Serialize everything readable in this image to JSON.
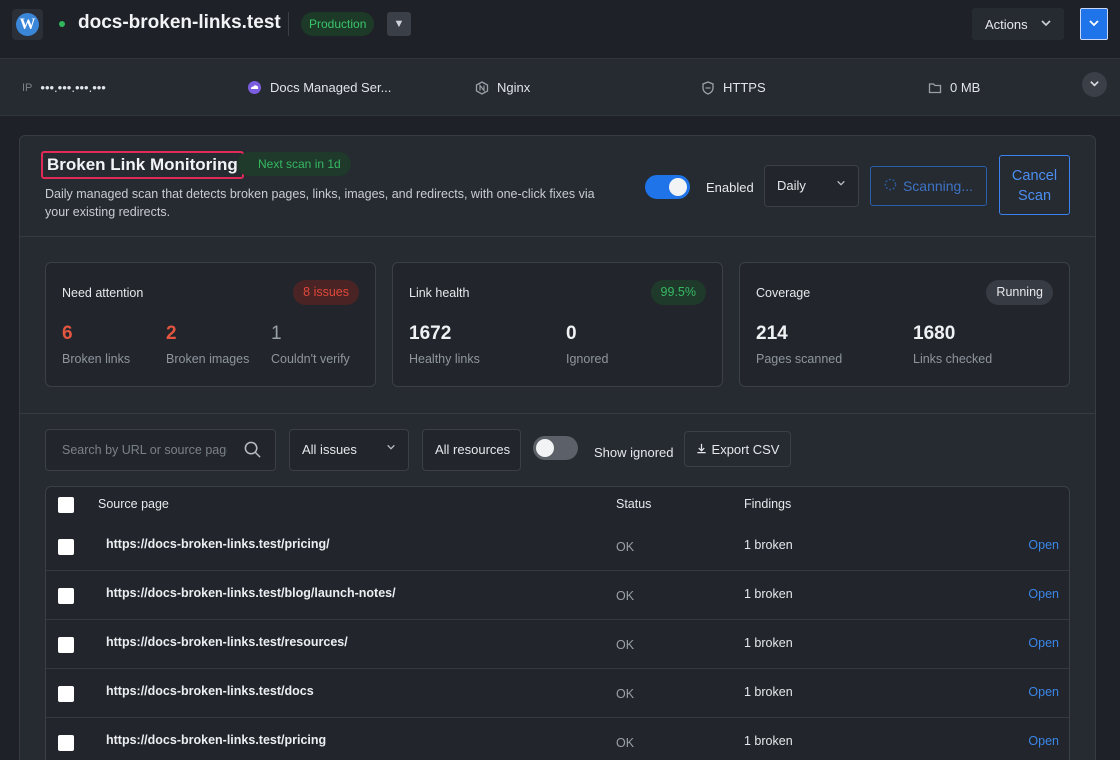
{
  "topbar": {
    "site_title": "docs-broken-links.test",
    "environment": "Production",
    "actions_label": "Actions",
    "logo_letter": "W"
  },
  "infobar": {
    "ip_label": "IP",
    "ip_value": "•••.•••.•••.•••",
    "service": "Docs Managed Ser...",
    "server": "Nginx",
    "https": "HTTPS",
    "storage": "0 MB"
  },
  "monitor": {
    "title": "Broken Link Monitoring",
    "next_scan": "Next scan in 1d",
    "description": "Daily managed scan that detects broken pages, links, images, and redirects, with one-click fixes via your existing redirects.",
    "enabled_label": "Enabled",
    "enabled": true,
    "frequency": "Daily",
    "scanning_label": "Scanning...",
    "cancel_label_1": "Cancel",
    "cancel_label_2": "Scan"
  },
  "stats": {
    "attention": {
      "title": "Need attention",
      "badge": "8 issues",
      "m1_value": "6",
      "m1_label": "Broken links",
      "m2_value": "2",
      "m2_label": "Broken images",
      "m3_value": "1",
      "m3_label": "Couldn't verify"
    },
    "health": {
      "title": "Link health",
      "badge": "99.5%",
      "m1_value": "1672",
      "m1_label": "Healthy links",
      "m2_value": "0",
      "m2_label": "Ignored"
    },
    "coverage": {
      "title": "Coverage",
      "badge": "Running",
      "m1_value": "214",
      "m1_label": "Pages scanned",
      "m2_value": "1680",
      "m2_label": "Links checked"
    }
  },
  "filters": {
    "search_placeholder": "Search by URL or source page",
    "issues_select": "All issues",
    "resources_select": "All resources",
    "show_ignored_label": "Show ignored",
    "show_ignored": false,
    "export_label": "Export CSV"
  },
  "table": {
    "headers": {
      "source": "Source page",
      "status": "Status",
      "findings": "Findings"
    },
    "open_label": "Open",
    "rows": [
      {
        "url": "https://docs-broken-links.test/pricing/",
        "status": "OK",
        "findings": "1 broken"
      },
      {
        "url": "https://docs-broken-links.test/blog/launch-notes/",
        "status": "OK",
        "findings": "1 broken"
      },
      {
        "url": "https://docs-broken-links.test/resources/",
        "status": "OK",
        "findings": "1 broken"
      },
      {
        "url": "https://docs-broken-links.test/docs",
        "status": "OK",
        "findings": "1 broken"
      },
      {
        "url": "https://docs-broken-links.test/pricing",
        "status": "OK",
        "findings": "1 broken"
      }
    ]
  },
  "colors": {
    "accent": "#1e74e8",
    "success": "#36b864",
    "danger": "#e0483b",
    "highlight": "#e02a58"
  }
}
